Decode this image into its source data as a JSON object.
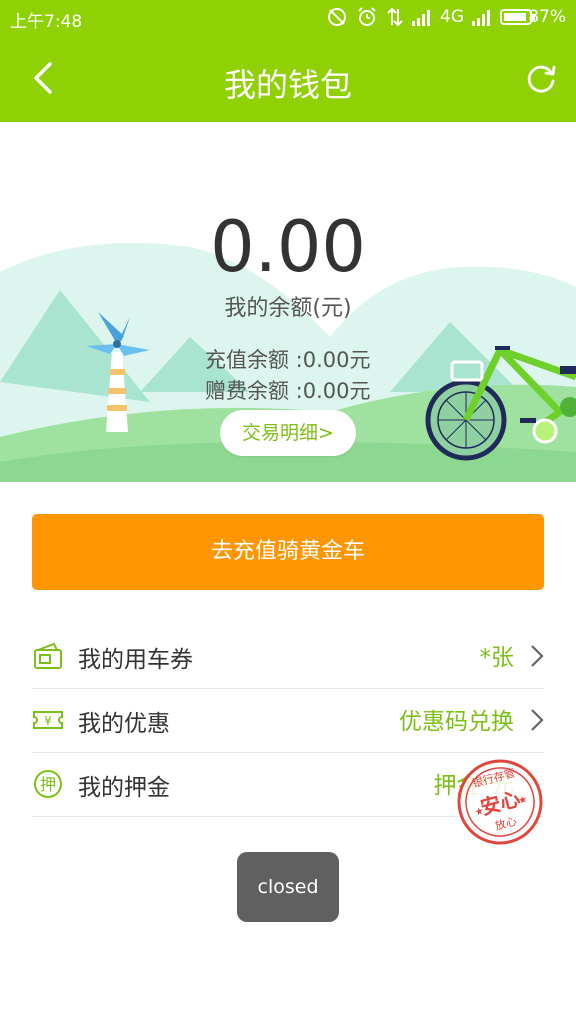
{
  "status_bar": {
    "time": "上午7:48",
    "network": "4G",
    "battery": "87%"
  },
  "header": {
    "title": "我的钱包"
  },
  "wallet": {
    "balance": "0.00",
    "balance_label": "我的余额(元)",
    "recharge_balance": "充值余额 :0.00元",
    "gift_balance": "赠费余额 :0.00元",
    "detail_button": "交易明细>"
  },
  "recharge_button": "去充值骑黄金车",
  "menu": [
    {
      "icon": "ticket-icon",
      "label": "我的用车券",
      "value": "*张"
    },
    {
      "icon": "coupon-icon",
      "label": "我的优惠",
      "value": "优惠码兑换"
    },
    {
      "icon": "deposit-icon",
      "label": "我的押金",
      "value": "押金*元"
    }
  ],
  "stamp": {
    "main": "安心",
    "top": "银行存管",
    "bottom": "放心"
  },
  "toast": "closed",
  "colors": {
    "brand_green": "#8fd104",
    "accent_orange": "#ff9501",
    "text_green": "#7cbf16"
  }
}
